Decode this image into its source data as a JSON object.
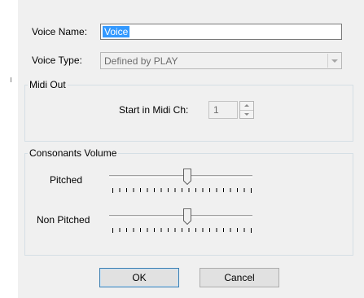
{
  "dialog": {
    "voice_name_label": "Voice Name:",
    "voice_name_value": "Voice",
    "voice_type_label": "Voice Type:",
    "voice_type_value": "Defined by PLAY",
    "midi_out": {
      "title": "Midi Out",
      "start_channel_label": "Start in Midi Ch:",
      "start_channel_value": "1"
    },
    "consonants_volume": {
      "title": "Consonants Volume",
      "pitched_label": "Pitched",
      "pitched_value_fraction": 0.55,
      "non_pitched_label": "Non Pitched",
      "non_pitched_value_fraction": 0.55
    },
    "ok_label": "OK",
    "cancel_label": "Cancel"
  },
  "colors": {
    "dialog_bg": "#f0f0f0",
    "selection": "#3399ff",
    "group_border": "#d5dfe5",
    "default_button_border": "#3c7fb1"
  },
  "icons": {
    "combo_arrow": "chevron-down-icon",
    "spin_up": "chevron-up-icon",
    "spin_down": "chevron-down-icon"
  }
}
